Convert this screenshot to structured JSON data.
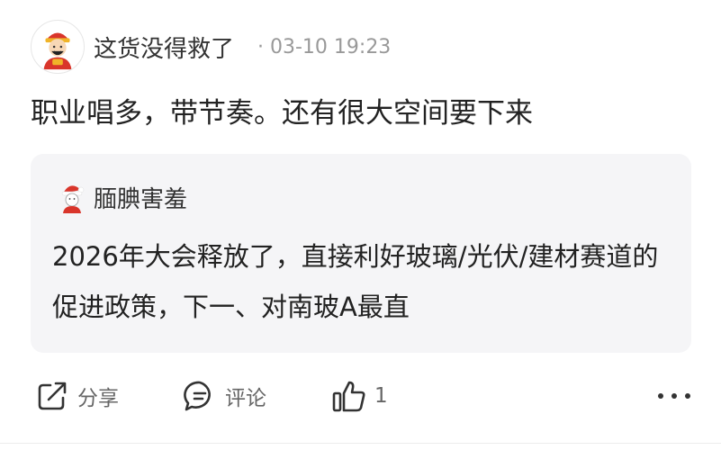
{
  "post": {
    "author": "这货没得救了",
    "meta": "· 03-10 19:23",
    "text": "职业唱多，带节奏。还有很大空间要下来"
  },
  "quoted": {
    "author": "腼腆害羞",
    "text": "2026年大会释放了，直接利好玻璃/光伏/建材赛道的促进政策，下一、对南玻A最直"
  },
  "actions": {
    "share_label": "分享",
    "comment_label": "评论",
    "like_count": "1"
  },
  "icons": {
    "share": "share-icon",
    "comment": "comment-icon",
    "like": "thumbs-up-icon",
    "more": "more-icon"
  }
}
